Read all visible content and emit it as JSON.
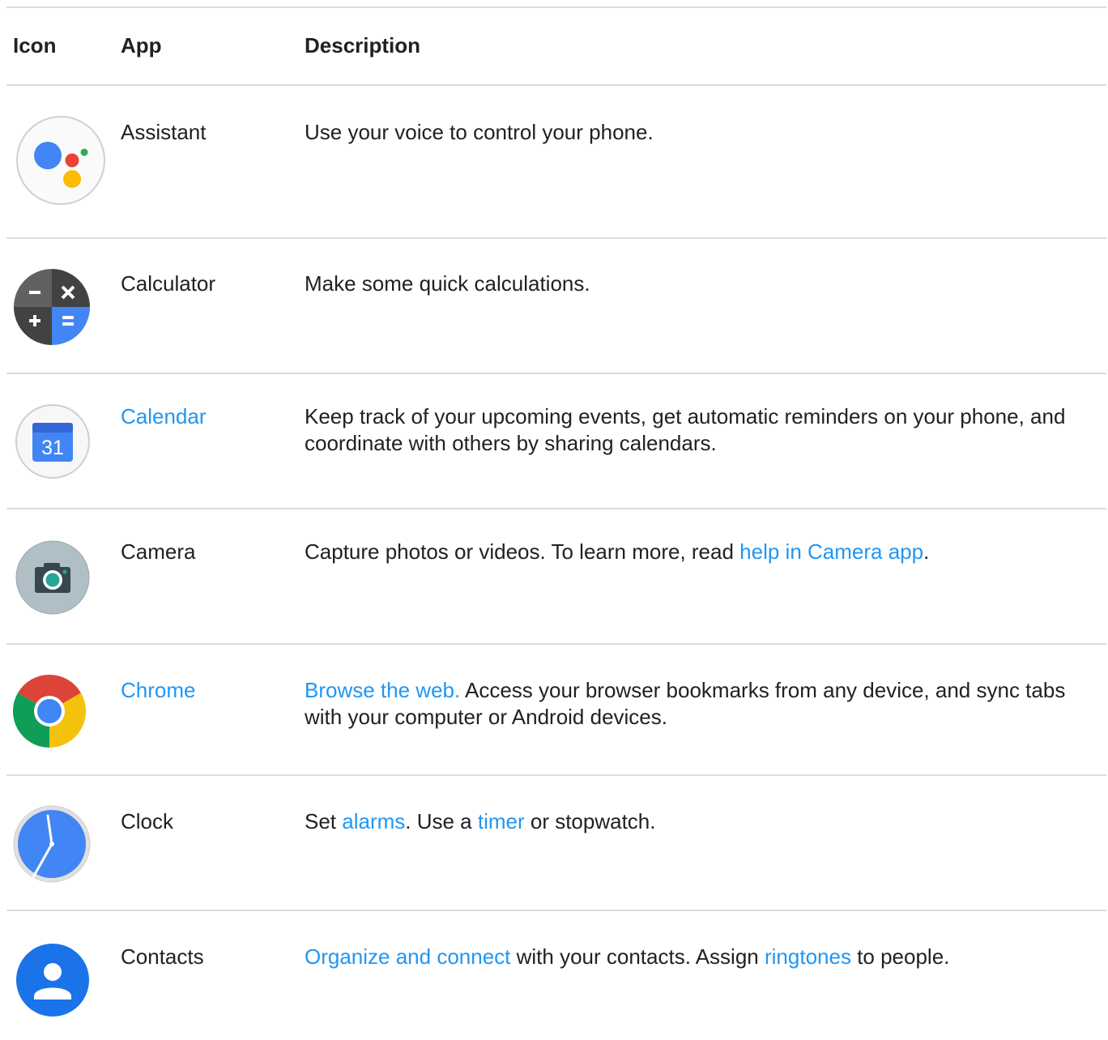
{
  "headers": {
    "icon": "Icon",
    "app": "App",
    "description": "Description"
  },
  "colors": {
    "link": "#2196f3",
    "divider": "#dadce0",
    "text": "#202124"
  },
  "rows": [
    {
      "icon": "assistant-icon",
      "app": "Assistant",
      "app_is_link": false,
      "desc": [
        "Use your voice to control your phone."
      ]
    },
    {
      "icon": "calculator-icon",
      "app": "Calculator",
      "app_is_link": false,
      "desc": [
        "Make some quick calculations."
      ]
    },
    {
      "icon": "calendar-icon",
      "app": "Calendar",
      "app_is_link": true,
      "calendar_day": "31",
      "desc": [
        "Keep track of your upcoming events, get automatic reminders on your phone, and coordinate with others by sharing calendars."
      ]
    },
    {
      "icon": "camera-icon",
      "app": "Camera",
      "app_is_link": false,
      "desc": [
        "Capture photos or videos. To learn more, read ",
        "help in Camera app",
        "."
      ]
    },
    {
      "icon": "chrome-icon",
      "app": "Chrome",
      "app_is_link": true,
      "desc": [
        "Browse the web.",
        " Access your browser bookmarks from any device, and sync tabs with your computer or Android devices."
      ]
    },
    {
      "icon": "clock-icon",
      "app": "Clock",
      "app_is_link": false,
      "desc": [
        "Set ",
        "alarms",
        ". Use a ",
        "timer",
        " or stopwatch."
      ]
    },
    {
      "icon": "contacts-icon",
      "app": "Contacts",
      "app_is_link": false,
      "desc": [
        "Organize and connect",
        " with your contacts. Assign ",
        "ringtones",
        " to people."
      ]
    }
  ]
}
